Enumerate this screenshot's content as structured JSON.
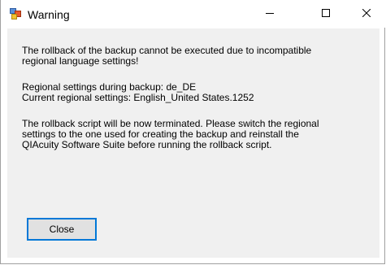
{
  "window": {
    "title": "Warning",
    "icons": {
      "app": "warning-app-icon",
      "minimize": "minimize-icon",
      "maximize": "maximize-icon",
      "close": "close-icon"
    }
  },
  "message": {
    "line1": "The rollback of the backup cannot be executed due to incompatible\nregional language settings!",
    "line2": "Regional settings during backup: de_DE\nCurrent regional settings: English_United States.1252",
    "line3": "The rollback script will be now terminated. Please switch the regional\nsettings to the one used for creating the backup and reinstall the\nQIAcuity Software Suite before running the rollback script."
  },
  "buttons": {
    "close_label": "Close"
  },
  "colors": {
    "dialog_background": "#f0f0f0",
    "button_focus_border": "#0078d7",
    "button_background": "#e1e1e1"
  }
}
